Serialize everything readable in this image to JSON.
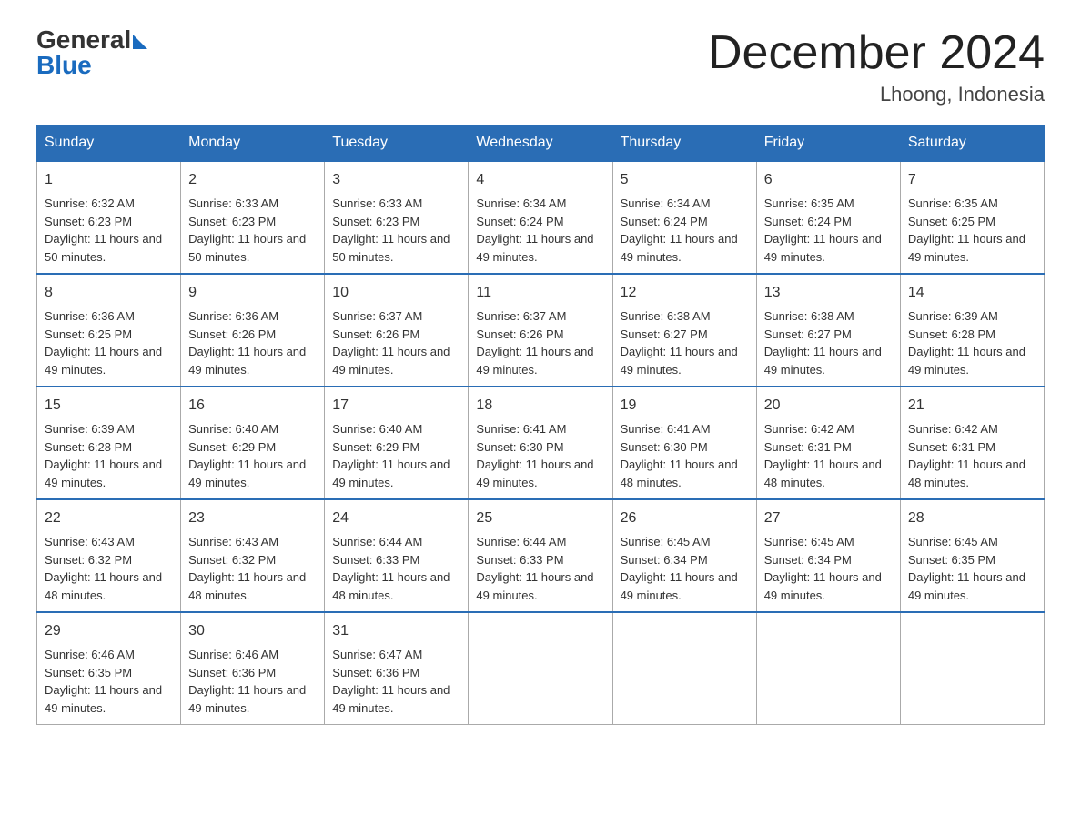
{
  "header": {
    "logo_general": "General",
    "logo_blue": "Blue",
    "month_title": "December 2024",
    "location": "Lhoong, Indonesia"
  },
  "weekdays": [
    "Sunday",
    "Monday",
    "Tuesday",
    "Wednesday",
    "Thursday",
    "Friday",
    "Saturday"
  ],
  "weeks": [
    [
      {
        "day": "1",
        "sunrise": "6:32 AM",
        "sunset": "6:23 PM",
        "daylight": "11 hours and 50 minutes."
      },
      {
        "day": "2",
        "sunrise": "6:33 AM",
        "sunset": "6:23 PM",
        "daylight": "11 hours and 50 minutes."
      },
      {
        "day": "3",
        "sunrise": "6:33 AM",
        "sunset": "6:23 PM",
        "daylight": "11 hours and 50 minutes."
      },
      {
        "day": "4",
        "sunrise": "6:34 AM",
        "sunset": "6:24 PM",
        "daylight": "11 hours and 49 minutes."
      },
      {
        "day": "5",
        "sunrise": "6:34 AM",
        "sunset": "6:24 PM",
        "daylight": "11 hours and 49 minutes."
      },
      {
        "day": "6",
        "sunrise": "6:35 AM",
        "sunset": "6:24 PM",
        "daylight": "11 hours and 49 minutes."
      },
      {
        "day": "7",
        "sunrise": "6:35 AM",
        "sunset": "6:25 PM",
        "daylight": "11 hours and 49 minutes."
      }
    ],
    [
      {
        "day": "8",
        "sunrise": "6:36 AM",
        "sunset": "6:25 PM",
        "daylight": "11 hours and 49 minutes."
      },
      {
        "day": "9",
        "sunrise": "6:36 AM",
        "sunset": "6:26 PM",
        "daylight": "11 hours and 49 minutes."
      },
      {
        "day": "10",
        "sunrise": "6:37 AM",
        "sunset": "6:26 PM",
        "daylight": "11 hours and 49 minutes."
      },
      {
        "day": "11",
        "sunrise": "6:37 AM",
        "sunset": "6:26 PM",
        "daylight": "11 hours and 49 minutes."
      },
      {
        "day": "12",
        "sunrise": "6:38 AM",
        "sunset": "6:27 PM",
        "daylight": "11 hours and 49 minutes."
      },
      {
        "day": "13",
        "sunrise": "6:38 AM",
        "sunset": "6:27 PM",
        "daylight": "11 hours and 49 minutes."
      },
      {
        "day": "14",
        "sunrise": "6:39 AM",
        "sunset": "6:28 PM",
        "daylight": "11 hours and 49 minutes."
      }
    ],
    [
      {
        "day": "15",
        "sunrise": "6:39 AM",
        "sunset": "6:28 PM",
        "daylight": "11 hours and 49 minutes."
      },
      {
        "day": "16",
        "sunrise": "6:40 AM",
        "sunset": "6:29 PM",
        "daylight": "11 hours and 49 minutes."
      },
      {
        "day": "17",
        "sunrise": "6:40 AM",
        "sunset": "6:29 PM",
        "daylight": "11 hours and 49 minutes."
      },
      {
        "day": "18",
        "sunrise": "6:41 AM",
        "sunset": "6:30 PM",
        "daylight": "11 hours and 49 minutes."
      },
      {
        "day": "19",
        "sunrise": "6:41 AM",
        "sunset": "6:30 PM",
        "daylight": "11 hours and 48 minutes."
      },
      {
        "day": "20",
        "sunrise": "6:42 AM",
        "sunset": "6:31 PM",
        "daylight": "11 hours and 48 minutes."
      },
      {
        "day": "21",
        "sunrise": "6:42 AM",
        "sunset": "6:31 PM",
        "daylight": "11 hours and 48 minutes."
      }
    ],
    [
      {
        "day": "22",
        "sunrise": "6:43 AM",
        "sunset": "6:32 PM",
        "daylight": "11 hours and 48 minutes."
      },
      {
        "day": "23",
        "sunrise": "6:43 AM",
        "sunset": "6:32 PM",
        "daylight": "11 hours and 48 minutes."
      },
      {
        "day": "24",
        "sunrise": "6:44 AM",
        "sunset": "6:33 PM",
        "daylight": "11 hours and 48 minutes."
      },
      {
        "day": "25",
        "sunrise": "6:44 AM",
        "sunset": "6:33 PM",
        "daylight": "11 hours and 49 minutes."
      },
      {
        "day": "26",
        "sunrise": "6:45 AM",
        "sunset": "6:34 PM",
        "daylight": "11 hours and 49 minutes."
      },
      {
        "day": "27",
        "sunrise": "6:45 AM",
        "sunset": "6:34 PM",
        "daylight": "11 hours and 49 minutes."
      },
      {
        "day": "28",
        "sunrise": "6:45 AM",
        "sunset": "6:35 PM",
        "daylight": "11 hours and 49 minutes."
      }
    ],
    [
      {
        "day": "29",
        "sunrise": "6:46 AM",
        "sunset": "6:35 PM",
        "daylight": "11 hours and 49 minutes."
      },
      {
        "day": "30",
        "sunrise": "6:46 AM",
        "sunset": "6:36 PM",
        "daylight": "11 hours and 49 minutes."
      },
      {
        "day": "31",
        "sunrise": "6:47 AM",
        "sunset": "6:36 PM",
        "daylight": "11 hours and 49 minutes."
      },
      null,
      null,
      null,
      null
    ]
  ],
  "labels": {
    "sunrise": "Sunrise:",
    "sunset": "Sunset:",
    "daylight": "Daylight:"
  }
}
